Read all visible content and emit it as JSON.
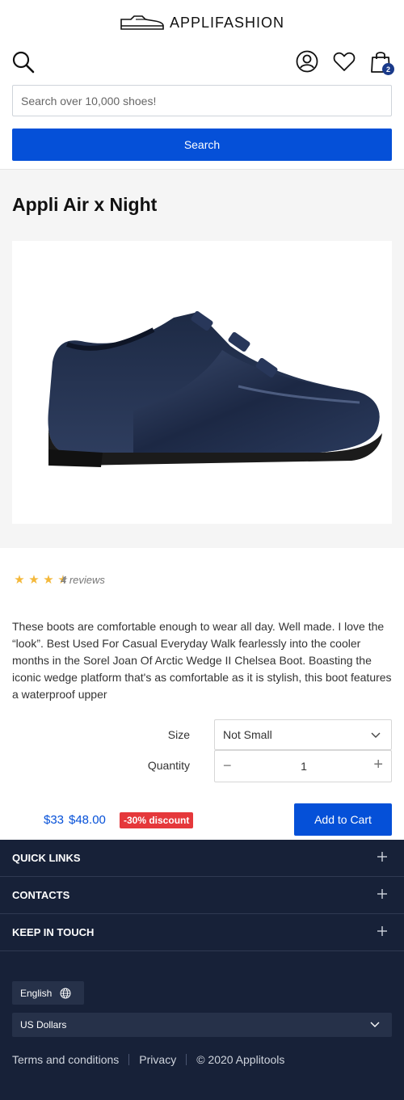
{
  "header": {
    "brand": "APPLIFASHION",
    "cart_count": "2",
    "search_placeholder": "Search over 10,000 shoes!",
    "search_button": "Search"
  },
  "product": {
    "title": "Appli Air x Night",
    "rating": 3.5,
    "rating_max": 5,
    "reviews": "4 reviews",
    "description": "These boots are comfortable enough to wear all day. Well made. I love the “look”. Best Used For Casual Everyday Walk fearlessly into the cooler months in the Sorel Joan Of Arctic Wedge II Chelsea Boot. Boasting the iconic wedge platform that's as comfortable as it is stylish, this boot features a waterproof upper",
    "size_label": "Size",
    "size_value": "Not Small",
    "quantity_label": "Quantity",
    "quantity_value": "1",
    "quantity_minus": "−",
    "quantity_plus": "+",
    "price_new": "$33",
    "price_old": "$48.00",
    "discount": "-30% discount",
    "add_to_cart": "Add to Cart"
  },
  "footer": {
    "sections": [
      {
        "label": "QUICK LINKS"
      },
      {
        "label": "CONTACTS"
      },
      {
        "label": "KEEP IN TOUCH"
      }
    ],
    "language": "English",
    "currency": "US Dollars",
    "links": {
      "terms": "Terms and conditions",
      "privacy": "Privacy",
      "copyright": "© 2020 Applitools"
    }
  },
  "colors": {
    "primary": "#0550d8",
    "footer_bg": "#172138",
    "discount_bg": "#e5383b",
    "star": "#f4b83a"
  }
}
